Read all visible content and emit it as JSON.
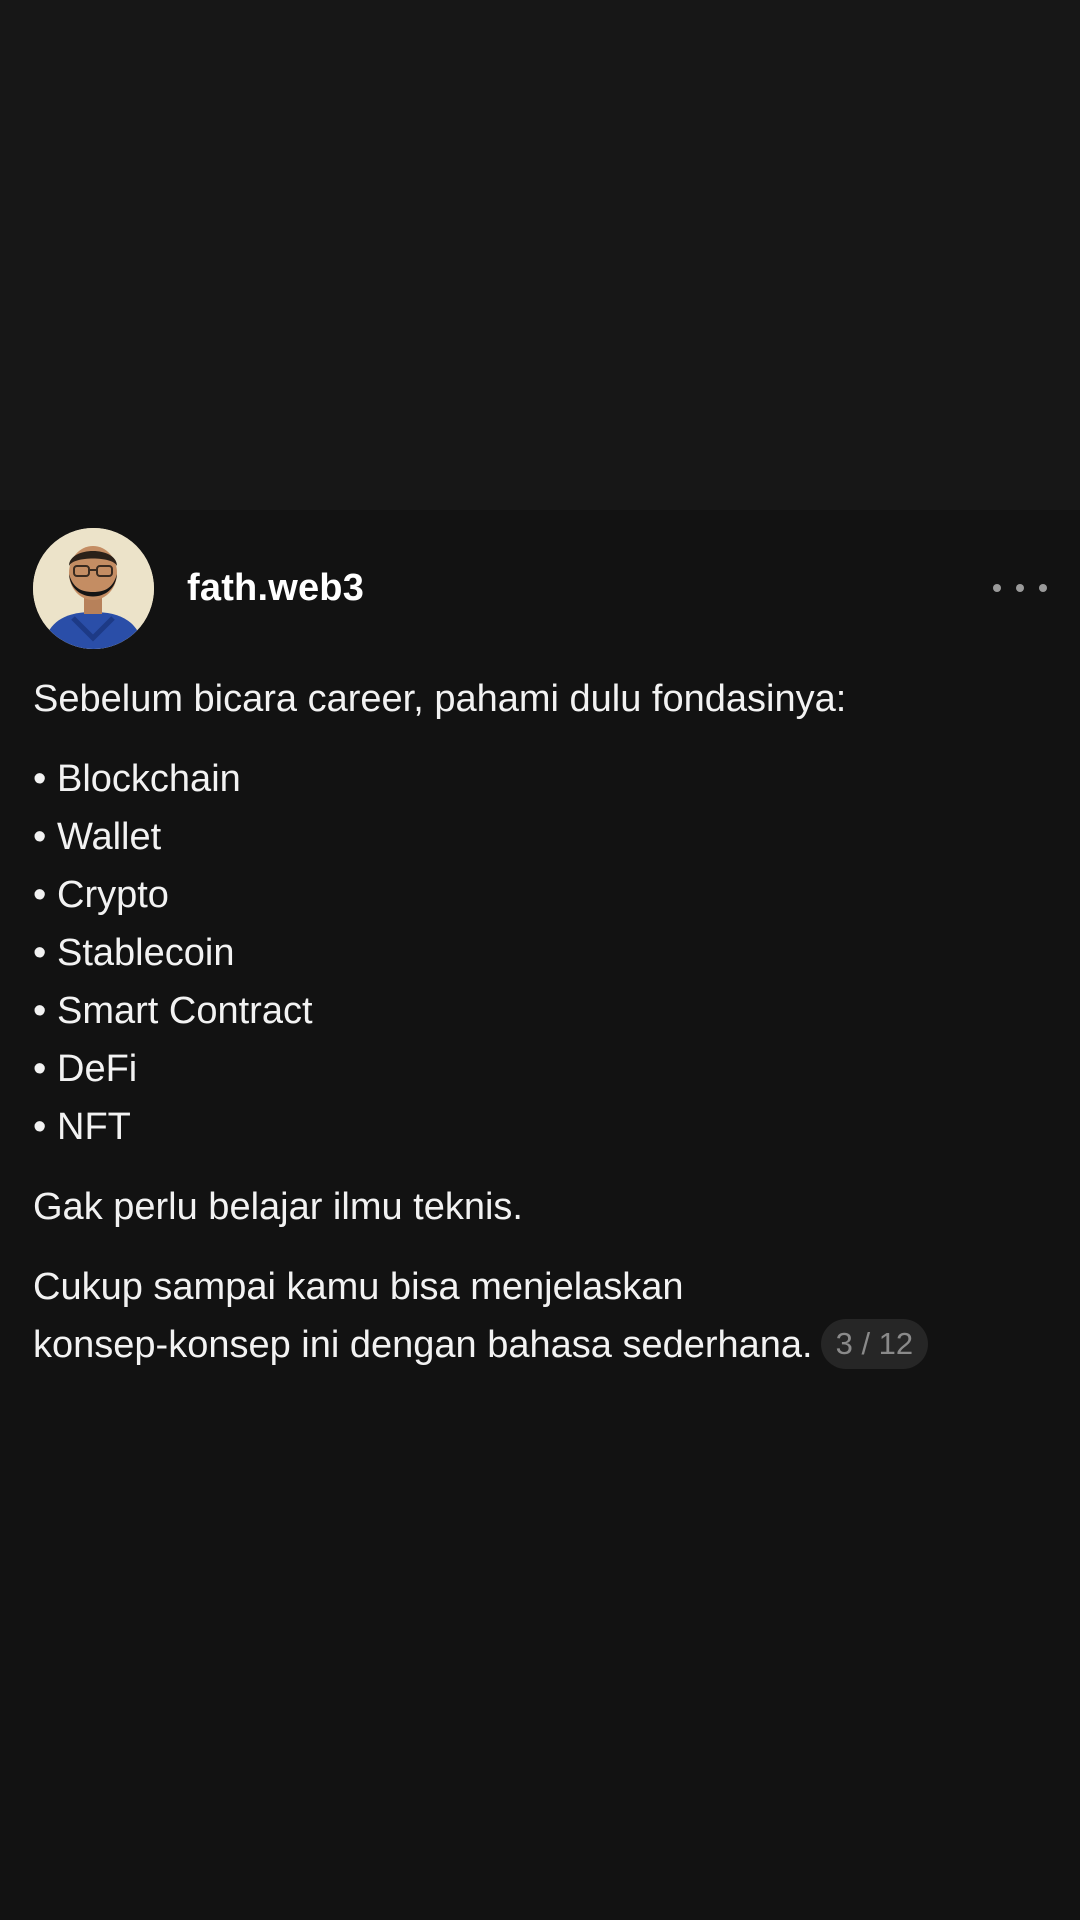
{
  "post": {
    "username": "fath.web3",
    "more_icon": "more-horizontal-icon",
    "intro": "Sebelum bicara career, pahami dulu fondasinya:",
    "bullet_char": "•",
    "items": [
      "Blockchain",
      "Wallet",
      "Crypto",
      "Stablecoin",
      "Smart Contract",
      "DeFi",
      "NFT"
    ],
    "paragraph_1": "Gak perlu belajar ilmu teknis.",
    "paragraph_2_line_1": "Cukup sampai kamu bisa menjelaskan",
    "paragraph_2_line_2": "konsep-konsep ini dengan bahasa sederhana.",
    "page_counter": "3 / 12"
  },
  "colors": {
    "background": "#121212",
    "top_area": "#171717",
    "text": "#f2f2f2",
    "counter_bg": "#262626",
    "counter_text": "#8a8a8a"
  }
}
